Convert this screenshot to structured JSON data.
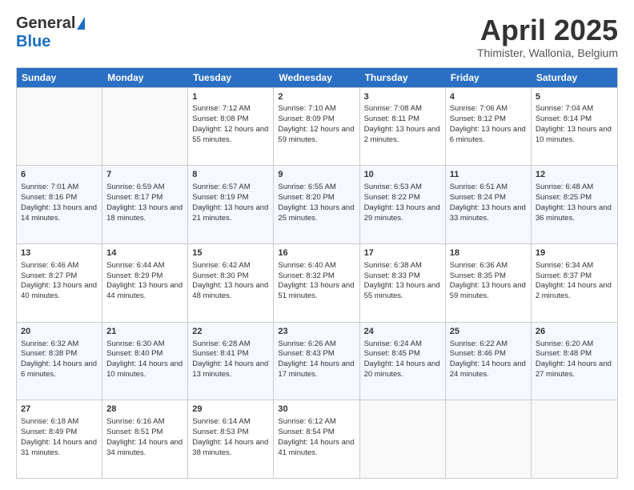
{
  "header": {
    "logo_general": "General",
    "logo_blue": "Blue",
    "title": "April 2025",
    "subtitle": "Thimister, Wallonia, Belgium"
  },
  "days_of_week": [
    "Sunday",
    "Monday",
    "Tuesday",
    "Wednesday",
    "Thursday",
    "Friday",
    "Saturday"
  ],
  "weeks": [
    [
      {
        "day": "",
        "sunrise": "",
        "sunset": "",
        "daylight": "",
        "empty": true
      },
      {
        "day": "",
        "sunrise": "",
        "sunset": "",
        "daylight": "",
        "empty": true
      },
      {
        "day": "1",
        "sunrise": "Sunrise: 7:12 AM",
        "sunset": "Sunset: 8:08 PM",
        "daylight": "Daylight: 12 hours and 55 minutes.",
        "empty": false
      },
      {
        "day": "2",
        "sunrise": "Sunrise: 7:10 AM",
        "sunset": "Sunset: 8:09 PM",
        "daylight": "Daylight: 12 hours and 59 minutes.",
        "empty": false
      },
      {
        "day": "3",
        "sunrise": "Sunrise: 7:08 AM",
        "sunset": "Sunset: 8:11 PM",
        "daylight": "Daylight: 13 hours and 2 minutes.",
        "empty": false
      },
      {
        "day": "4",
        "sunrise": "Sunrise: 7:06 AM",
        "sunset": "Sunset: 8:12 PM",
        "daylight": "Daylight: 13 hours and 6 minutes.",
        "empty": false
      },
      {
        "day": "5",
        "sunrise": "Sunrise: 7:04 AM",
        "sunset": "Sunset: 8:14 PM",
        "daylight": "Daylight: 13 hours and 10 minutes.",
        "empty": false
      }
    ],
    [
      {
        "day": "6",
        "sunrise": "Sunrise: 7:01 AM",
        "sunset": "Sunset: 8:16 PM",
        "daylight": "Daylight: 13 hours and 14 minutes.",
        "empty": false
      },
      {
        "day": "7",
        "sunrise": "Sunrise: 6:59 AM",
        "sunset": "Sunset: 8:17 PM",
        "daylight": "Daylight: 13 hours and 18 minutes.",
        "empty": false
      },
      {
        "day": "8",
        "sunrise": "Sunrise: 6:57 AM",
        "sunset": "Sunset: 8:19 PM",
        "daylight": "Daylight: 13 hours and 21 minutes.",
        "empty": false
      },
      {
        "day": "9",
        "sunrise": "Sunrise: 6:55 AM",
        "sunset": "Sunset: 8:20 PM",
        "daylight": "Daylight: 13 hours and 25 minutes.",
        "empty": false
      },
      {
        "day": "10",
        "sunrise": "Sunrise: 6:53 AM",
        "sunset": "Sunset: 8:22 PM",
        "daylight": "Daylight: 13 hours and 29 minutes.",
        "empty": false
      },
      {
        "day": "11",
        "sunrise": "Sunrise: 6:51 AM",
        "sunset": "Sunset: 8:24 PM",
        "daylight": "Daylight: 13 hours and 33 minutes.",
        "empty": false
      },
      {
        "day": "12",
        "sunrise": "Sunrise: 6:48 AM",
        "sunset": "Sunset: 8:25 PM",
        "daylight": "Daylight: 13 hours and 36 minutes.",
        "empty": false
      }
    ],
    [
      {
        "day": "13",
        "sunrise": "Sunrise: 6:46 AM",
        "sunset": "Sunset: 8:27 PM",
        "daylight": "Daylight: 13 hours and 40 minutes.",
        "empty": false
      },
      {
        "day": "14",
        "sunrise": "Sunrise: 6:44 AM",
        "sunset": "Sunset: 8:29 PM",
        "daylight": "Daylight: 13 hours and 44 minutes.",
        "empty": false
      },
      {
        "day": "15",
        "sunrise": "Sunrise: 6:42 AM",
        "sunset": "Sunset: 8:30 PM",
        "daylight": "Daylight: 13 hours and 48 minutes.",
        "empty": false
      },
      {
        "day": "16",
        "sunrise": "Sunrise: 6:40 AM",
        "sunset": "Sunset: 8:32 PM",
        "daylight": "Daylight: 13 hours and 51 minutes.",
        "empty": false
      },
      {
        "day": "17",
        "sunrise": "Sunrise: 6:38 AM",
        "sunset": "Sunset: 8:33 PM",
        "daylight": "Daylight: 13 hours and 55 minutes.",
        "empty": false
      },
      {
        "day": "18",
        "sunrise": "Sunrise: 6:36 AM",
        "sunset": "Sunset: 8:35 PM",
        "daylight": "Daylight: 13 hours and 59 minutes.",
        "empty": false
      },
      {
        "day": "19",
        "sunrise": "Sunrise: 6:34 AM",
        "sunset": "Sunset: 8:37 PM",
        "daylight": "Daylight: 14 hours and 2 minutes.",
        "empty": false
      }
    ],
    [
      {
        "day": "20",
        "sunrise": "Sunrise: 6:32 AM",
        "sunset": "Sunset: 8:38 PM",
        "daylight": "Daylight: 14 hours and 6 minutes.",
        "empty": false
      },
      {
        "day": "21",
        "sunrise": "Sunrise: 6:30 AM",
        "sunset": "Sunset: 8:40 PM",
        "daylight": "Daylight: 14 hours and 10 minutes.",
        "empty": false
      },
      {
        "day": "22",
        "sunrise": "Sunrise: 6:28 AM",
        "sunset": "Sunset: 8:41 PM",
        "daylight": "Daylight: 14 hours and 13 minutes.",
        "empty": false
      },
      {
        "day": "23",
        "sunrise": "Sunrise: 6:26 AM",
        "sunset": "Sunset: 8:43 PM",
        "daylight": "Daylight: 14 hours and 17 minutes.",
        "empty": false
      },
      {
        "day": "24",
        "sunrise": "Sunrise: 6:24 AM",
        "sunset": "Sunset: 8:45 PM",
        "daylight": "Daylight: 14 hours and 20 minutes.",
        "empty": false
      },
      {
        "day": "25",
        "sunrise": "Sunrise: 6:22 AM",
        "sunset": "Sunset: 8:46 PM",
        "daylight": "Daylight: 14 hours and 24 minutes.",
        "empty": false
      },
      {
        "day": "26",
        "sunrise": "Sunrise: 6:20 AM",
        "sunset": "Sunset: 8:48 PM",
        "daylight": "Daylight: 14 hours and 27 minutes.",
        "empty": false
      }
    ],
    [
      {
        "day": "27",
        "sunrise": "Sunrise: 6:18 AM",
        "sunset": "Sunset: 8:49 PM",
        "daylight": "Daylight: 14 hours and 31 minutes.",
        "empty": false
      },
      {
        "day": "28",
        "sunrise": "Sunrise: 6:16 AM",
        "sunset": "Sunset: 8:51 PM",
        "daylight": "Daylight: 14 hours and 34 minutes.",
        "empty": false
      },
      {
        "day": "29",
        "sunrise": "Sunrise: 6:14 AM",
        "sunset": "Sunset: 8:53 PM",
        "daylight": "Daylight: 14 hours and 38 minutes.",
        "empty": false
      },
      {
        "day": "30",
        "sunrise": "Sunrise: 6:12 AM",
        "sunset": "Sunset: 8:54 PM",
        "daylight": "Daylight: 14 hours and 41 minutes.",
        "empty": false
      },
      {
        "day": "",
        "sunrise": "",
        "sunset": "",
        "daylight": "",
        "empty": true
      },
      {
        "day": "",
        "sunrise": "",
        "sunset": "",
        "daylight": "",
        "empty": true
      },
      {
        "day": "",
        "sunrise": "",
        "sunset": "",
        "daylight": "",
        "empty": true
      }
    ]
  ]
}
